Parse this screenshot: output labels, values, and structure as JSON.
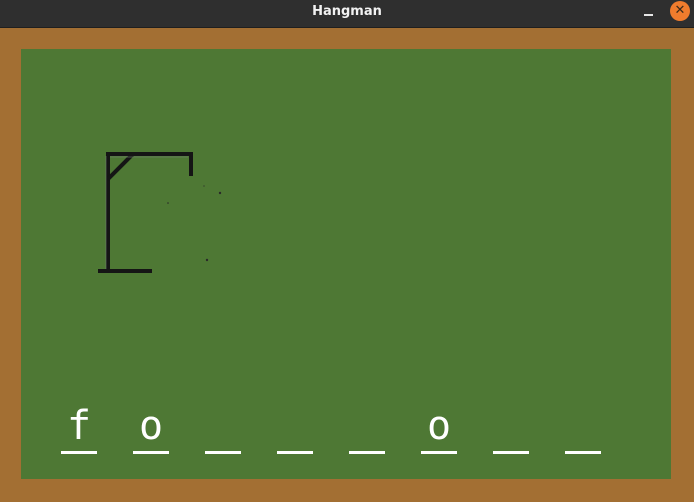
{
  "window": {
    "title": "Hangman",
    "minimize_label": "_",
    "close_label": "✕"
  },
  "game": {
    "letters": [
      "f",
      "o",
      "",
      "",
      "",
      "o",
      "",
      ""
    ]
  },
  "colors": {
    "chalkboard": "#4e7834",
    "frame": "#a36f33",
    "chalk": "#ffffff"
  }
}
